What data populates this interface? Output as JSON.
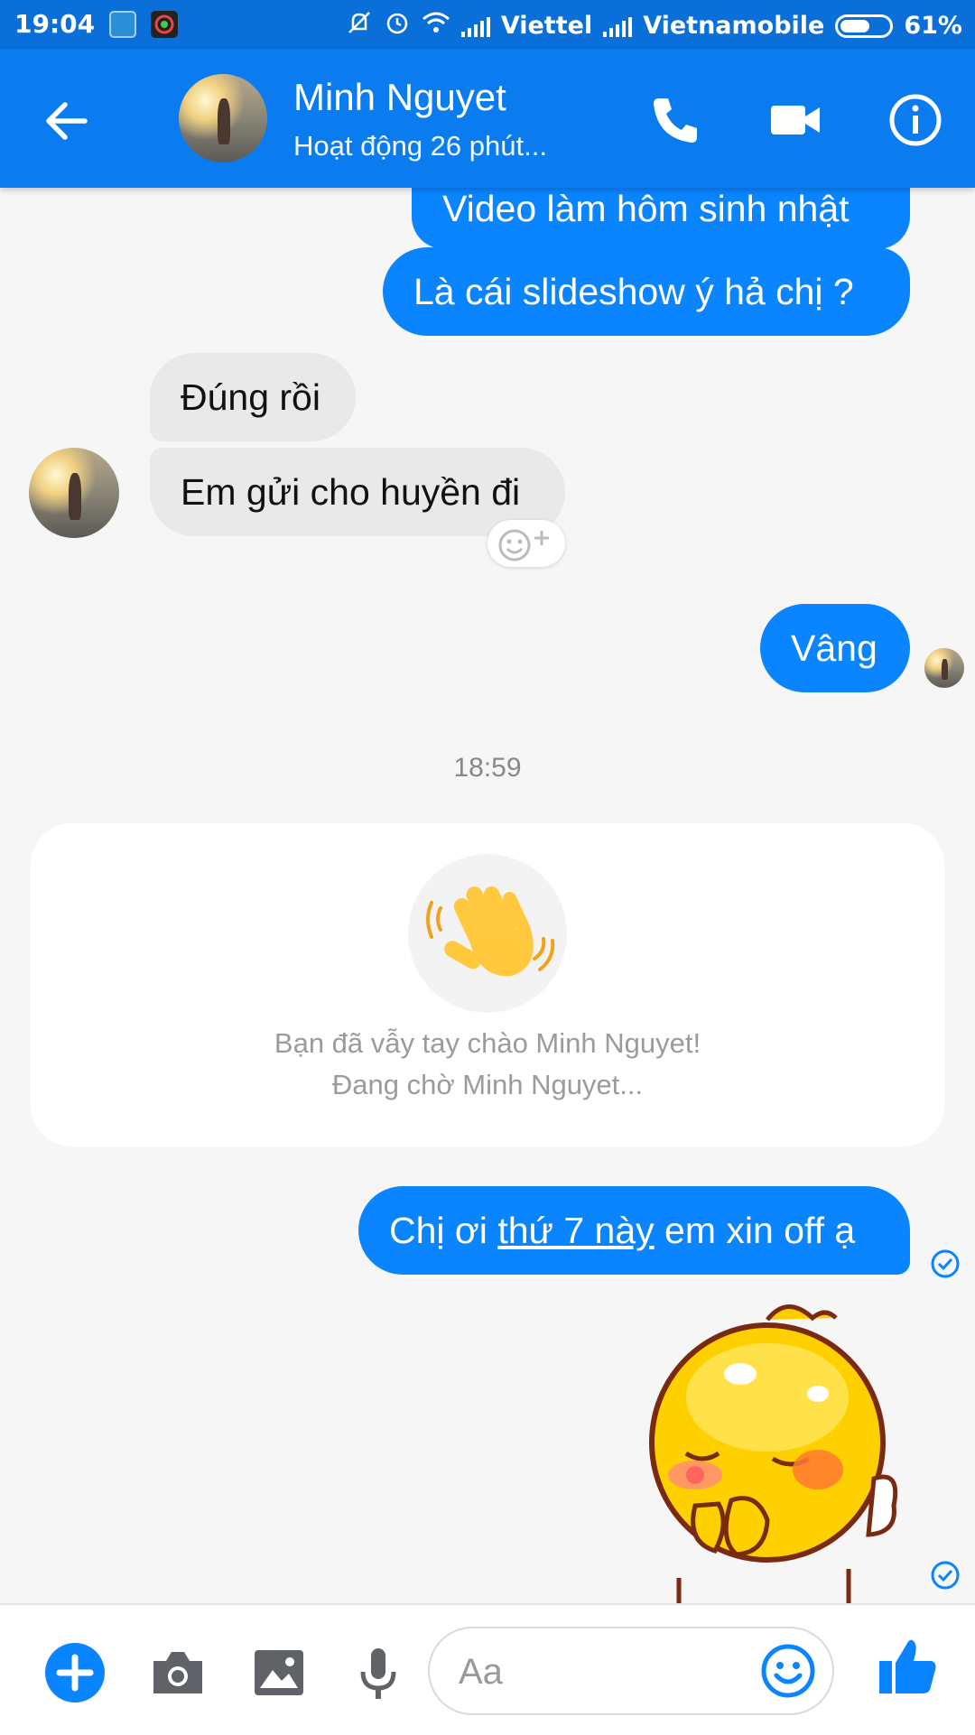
{
  "status_bar": {
    "time": "19:04",
    "carrier1": "Viettel",
    "carrier2": "Vietnamobile",
    "battery": "61%",
    "battery_level": 0.61
  },
  "header": {
    "contact_name": "Minh Nguyet",
    "contact_status": "Hoạt động 26 phút...",
    "icons": [
      "back-arrow-icon",
      "phone-icon",
      "video-camera-icon",
      "info-icon"
    ]
  },
  "messages": {
    "m1": "Video làm hôm sinh nhật",
    "m2": "Là cái slideshow ý hả chị ?",
    "m3": "Đúng rồi",
    "m4": "Em gửi cho huyền đi",
    "m5": "Vâng",
    "m6_pre": "Chị ơi ",
    "m6_link": "thứ 7 này",
    "m6_post": " em xin off ạ"
  },
  "timestamp": "18:59",
  "wave_card": {
    "line1": "Bạn đã vẫy tay chào Minh Nguyet!",
    "line2": "Đang chờ Minh Nguyet..."
  },
  "composer": {
    "placeholder": "Aa",
    "icons": [
      "add-icon",
      "camera-icon",
      "image-icon",
      "microphone-icon",
      "emoji-icon",
      "like-icon"
    ]
  },
  "colors": {
    "header": "#0a7cf0",
    "status_bar": "#0a6fd8",
    "outgoing_bubble": "#0a84ff",
    "incoming_bubble": "#e9e9e9"
  }
}
